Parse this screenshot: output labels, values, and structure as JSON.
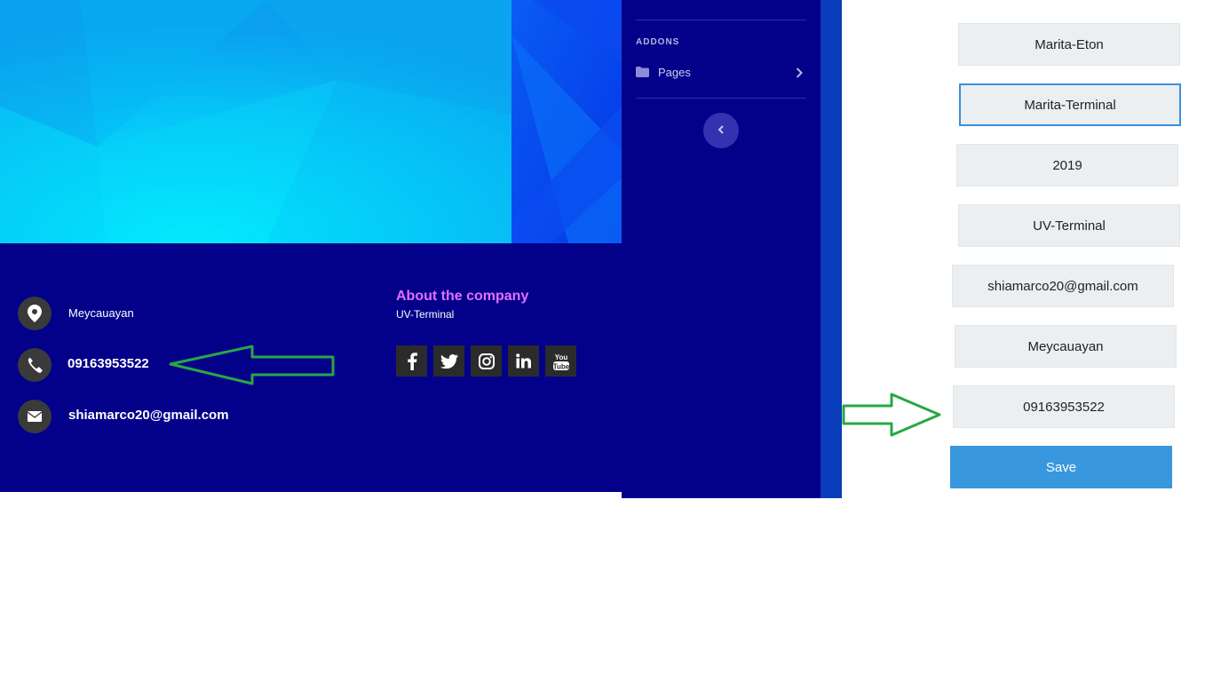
{
  "footer": {
    "contacts": [
      {
        "icon": "map-pin-icon",
        "text": "Meycauayan"
      },
      {
        "icon": "phone-icon",
        "text": "09163953522"
      },
      {
        "icon": "envelope-icon",
        "text": "shiamarco20@gmail.com"
      }
    ],
    "about_title": "About the company",
    "about_subtitle": "UV-Terminal",
    "social_icons": [
      "facebook-icon",
      "twitter-icon",
      "instagram-icon",
      "linkedin-icon",
      "youtube-icon"
    ],
    "youtube_label": "You Tube"
  },
  "sidebar": {
    "section_heading": "ADDONS",
    "items": [
      {
        "label": "Pages",
        "icon": "folder-icon"
      }
    ]
  },
  "form": {
    "fields": [
      {
        "value": "Marita-Eton"
      },
      {
        "value": "Marita-Terminal"
      },
      {
        "value": "2019"
      },
      {
        "value": "UV-Terminal"
      },
      {
        "value": "shiamarco20@gmail.com"
      },
      {
        "value": "Meycauayan"
      },
      {
        "value": "09163953522"
      }
    ],
    "save_label": "Save"
  },
  "colors": {
    "footer_bg": "#03008a",
    "accent_pink": "#e36fff",
    "button_blue": "#3897dd",
    "annotation_green": "#27a844"
  }
}
